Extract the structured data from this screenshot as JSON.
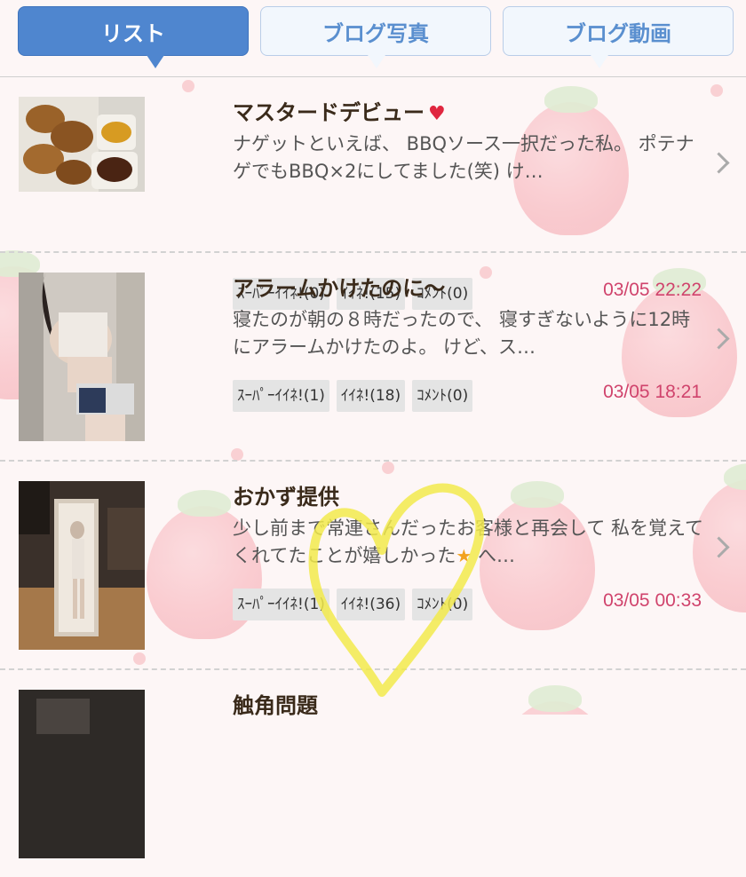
{
  "tabs": [
    {
      "label": "リスト",
      "active": true
    },
    {
      "label": "ブログ写真",
      "active": false
    },
    {
      "label": "ブログ動画",
      "active": false
    }
  ],
  "posts": [
    {
      "title": "マスタードデビュー",
      "title_icon": "heart-icon",
      "excerpt": "ナゲットといえば、 BBQソース一択だった私。 ポテナゲでもBBQ×2にしてました(笑) け…",
      "badges": [
        "ｽｰﾊﾟｰｲｲﾈ!(0)",
        "ｲｲﾈ!(15)",
        "ｺﾒﾝﾄ(0)"
      ],
      "date": "03/05 22:22"
    },
    {
      "title": "アラームかけたのに～",
      "excerpt": "寝たのが朝の８時だったので、 寝すぎないように12時にアラームかけたのよ。 けど、ス…",
      "badges": [
        "ｽｰﾊﾟｰｲｲﾈ!(1)",
        "ｲｲﾈ!(18)",
        "ｺﾒﾝﾄ(0)"
      ],
      "date": "03/05 18:21"
    },
    {
      "title": "おかず提供",
      "excerpt_a": "少し前まで常連さんだったお客様と再会して 私を覚えてくれてたことが嬉しかった",
      "excerpt_b": " へ…",
      "excerpt_icon": "star-icon",
      "badges": [
        "ｽｰﾊﾟｰｲｲﾈ!(1)",
        "ｲｲﾈ!(36)",
        "ｺﾒﾝﾄ(0)"
      ],
      "date": "03/05 00:33"
    },
    {
      "title": "触角問題"
    }
  ],
  "colors": {
    "tab_active": "#4f86cf",
    "tab_inactive_text": "#5a8fcf",
    "date": "#d0436c"
  }
}
